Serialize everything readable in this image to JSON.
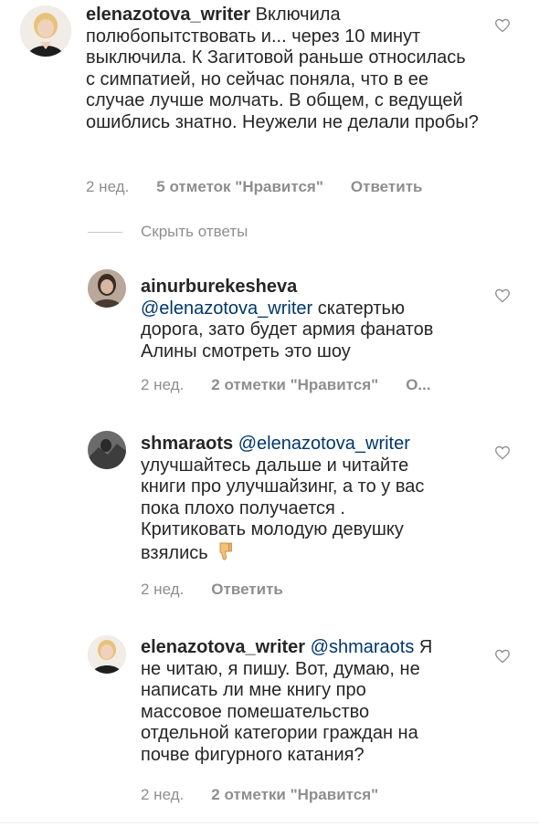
{
  "comments": [
    {
      "username": "elenazotova_writer",
      "mention": "",
      "text": "Включила полюбопытствовать и... через 10 минут выключила. К Загитовой раньше относилась с симпатией, но сейчас поняла, что в ее случае лучше молчать. В общем, с ведущей ошиблись знатно. Неужели не делали пробы?",
      "time": "2 нед.",
      "likes": "5 отметок \"Нравится\"",
      "reply": "Ответить"
    },
    {
      "username": "ainurburekesheva",
      "mention": "@elenazotova_writer",
      "text": "скатертью дорога, зато будет армия фанатов Алины смотреть это шоу",
      "time": "2 нед.",
      "likes": "2 отметки \"Нравится\"",
      "reply": "О..."
    },
    {
      "username": "shmaraots",
      "mention": "@elenazotova_writer",
      "text": "улучшайтесь дальше и читайте книги про улучшайзинг, а то у вас пока плохо получается . Критиковать молодую девушку взялись",
      "time": "2 нед.",
      "likes": "",
      "reply": "Ответить"
    },
    {
      "username": "elenazotova_writer",
      "mention": "@shmaraots",
      "text": "Я не читаю, я пишу.  Вот, думаю, не написать ли мне книгу про массовое помешательство отдельной категории граждан на почве фигурного катания?",
      "time": "2 нед.",
      "likes": "2 отметки \"Нравится\"",
      "reply": ""
    }
  ],
  "hide_replies_label": "Скрыть ответы",
  "icons": {
    "like": "heart-outline-icon",
    "emoji": "thumbs-down-icon"
  },
  "colors": {
    "text": "#262626",
    "meta": "#8e8e8e",
    "mention": "#00376b"
  }
}
